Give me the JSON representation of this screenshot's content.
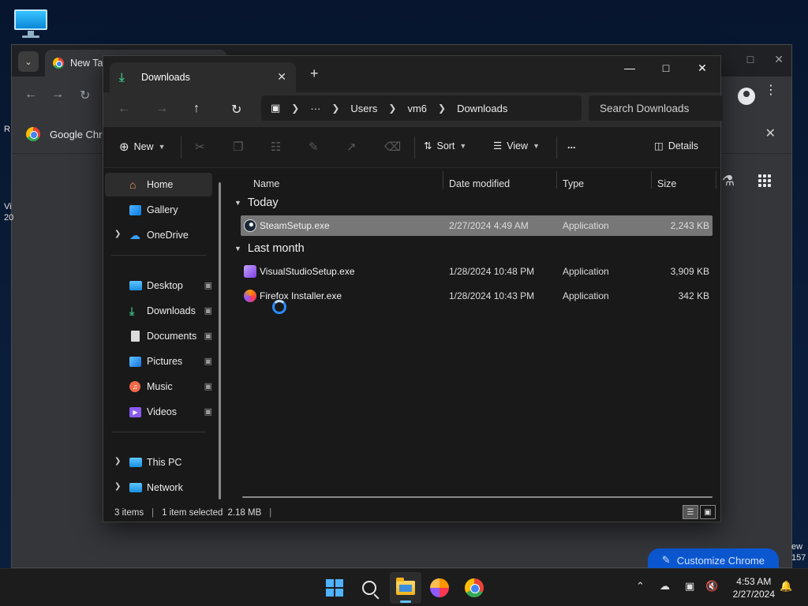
{
  "desktop": {
    "icon": "monitor-icon"
  },
  "chrome": {
    "tab_title": "New Tab",
    "bookmark_label": "Google Chrome",
    "left_edge_text": [
      "R",
      "Vi",
      "20"
    ],
    "right_edge_text": [
      "ew",
      "157"
    ],
    "customize_label": "Customize Chrome"
  },
  "explorer": {
    "tab_title": "Downloads",
    "breadcrumb": [
      "Users",
      "vm6",
      "Downloads"
    ],
    "search_placeholder": "Search Downloads",
    "commands": {
      "new": "New",
      "sort": "Sort",
      "view": "View",
      "more": "...",
      "details": "Details"
    },
    "nav": {
      "home": "Home",
      "gallery": "Gallery",
      "onedrive": "OneDrive",
      "quick": [
        {
          "label": "Desktop"
        },
        {
          "label": "Downloads"
        },
        {
          "label": "Documents"
        },
        {
          "label": "Pictures"
        },
        {
          "label": "Music"
        },
        {
          "label": "Videos"
        }
      ],
      "this_pc": "This PC",
      "network": "Network"
    },
    "columns": {
      "name": "Name",
      "date": "Date modified",
      "type": "Type",
      "size": "Size"
    },
    "groups": [
      {
        "label": "Today",
        "files": [
          {
            "name": "SteamSetup.exe",
            "date": "2/27/2024 4:49 AM",
            "type": "Application",
            "size": "2,243 KB",
            "selected": true
          }
        ]
      },
      {
        "label": "Last month",
        "files": [
          {
            "name": "VisualStudioSetup.exe",
            "date": "1/28/2024 10:48 PM",
            "type": "Application",
            "size": "3,909 KB"
          },
          {
            "name": "Firefox Installer.exe",
            "date": "1/28/2024 10:43 PM",
            "type": "Application",
            "size": "342 KB"
          }
        ]
      }
    ],
    "status": {
      "items": "3 items",
      "selected": "1 item selected",
      "size": "2.18 MB"
    }
  },
  "taskbar": {
    "clock_time": "4:53 AM",
    "clock_date": "2/27/2024"
  }
}
